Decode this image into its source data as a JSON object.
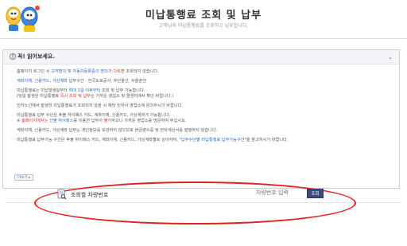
{
  "header": {
    "title": "미납통행료 조회 및 납부",
    "subtitle": "고객님의 미납통행료를 조회하고 납부합니다."
  },
  "notice": {
    "title": "꼭! 읽어보세요.",
    "collapse_symbol": "⌄",
    "info_symbol": "!",
    "item1": {
      "a": "홈페이지 로그인 시 ",
      "b": "고객명의",
      "c": " 및 ",
      "d": "자동차등록증의 명의",
      "e": "가 ",
      "f": "다르면",
      "g": " 조회되지 않습니다."
    },
    "item2": {
      "a": "계좌이체",
      "b": ", ",
      "c": "신용카드",
      "d": ", ",
      "e": "가상계좌",
      "f": " 납부구간 : 한국도로공사, 부산울산, 서울춘천"
    },
    "item3": {
      "a": "미납통행료는 미납발생일부터 ",
      "b": "최대 1일 이후부터",
      "c": " 조회 및 납부 가능합니다."
    },
    "item3_sub": {
      "a": "(당일 발생한 미납통행료 ",
      "b": "즉시 조회 및 납부",
      "c": "는 가까운 영업소 및 콜센터에서 확인 바랍니다.)"
    },
    "item4": "민자노선에서 발생한 미납통행료가 조회되지 않을 시 해당 민자사 영업소에 문의하시기 바랍니다.",
    "item5": "미납통행료 납부 수단은 후불 하이패스 카드, 계좌이체, 신용카드, 가상계좌가 가능합니다.",
    "item5_sub": {
      "a": "※ ",
      "b": "홈페이지에서는",
      "c": " 선불 하이패스",
      "d": "를 이용한 납부가 ",
      "e": "불가",
      "f": "하오니 가까운 영업소를 방문하여 주십시요."
    },
    "item6": "계좌이체, 신용카드, 가상계좌 납부는 개인정보를 보관하지 않으므로 현금영수증 및 전자계산서를 발행하지 않습니다.",
    "item7": {
      "a": "미납통행료 납부가능 구간은 후불 하이패스 카드, 계좌이체, 신용카드, 가상계좌별로 상이하여, ",
      "b": "\"납부수단별 미납통행료 납부가능구간\"",
      "c": "을 참고하시기 바랍니다."
    },
    "more_button": "더보기 ▸"
  },
  "search": {
    "label": "조회할 차량번호",
    "placeholder": "차량번호 입력",
    "button": "조회"
  },
  "colors": {
    "accent_blue": "#2a6bd1",
    "warning_red": "#d8342b",
    "search_button": "#3b4b80",
    "highlight_oval": "#e12020"
  }
}
